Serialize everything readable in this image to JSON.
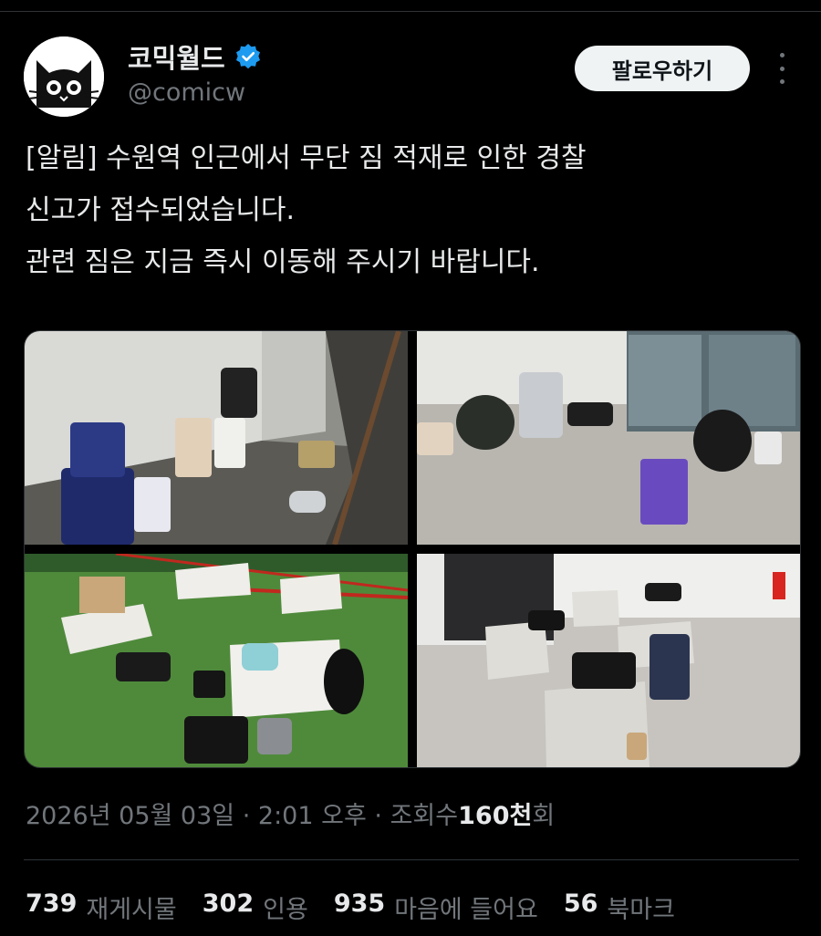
{
  "author": {
    "display_name": "코믹월드",
    "handle": "@comicw",
    "verified": true,
    "avatar_icon": "black-cat-icon"
  },
  "follow_label": "팔로우하기",
  "tweet": {
    "lines": [
      "[알림] 수원역 인근에서 무단 짐 적재로 인한 경찰",
      "신고가 접수되었습니다.",
      "관련 짐은 지금 즉시 이동해 주시기 바랍니다."
    ]
  },
  "meta": {
    "date": "2026년 05월 03일",
    "separator": "·",
    "time": "2:01 오후",
    "views_label": "조회수",
    "views_value": "160천",
    "views_suffix": "회"
  },
  "stats": [
    {
      "value": "739",
      "label": "재게시물"
    },
    {
      "value": "302",
      "label": "인용"
    },
    {
      "value": "935",
      "label": "마음에 들어요"
    },
    {
      "value": "56",
      "label": "북마크"
    }
  ],
  "colors": {
    "background": "#000000",
    "text_primary": "#e7e9ea",
    "text_secondary": "#71767b",
    "verified_blue": "#1d9bf0",
    "follow_bg": "#eff3f4"
  }
}
